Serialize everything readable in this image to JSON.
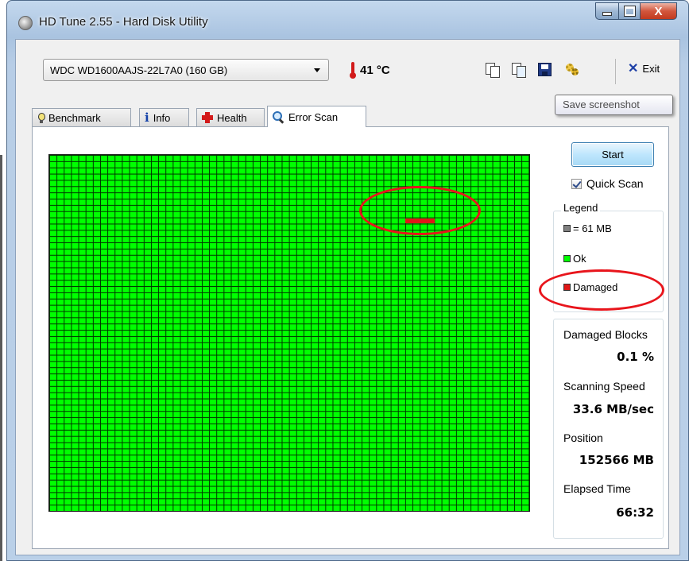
{
  "window": {
    "title": "HD Tune 2.55 - Hard Disk Utility",
    "buttons": {
      "minimize": "minimize",
      "maximize": "maximize",
      "close": "X"
    }
  },
  "toolbar": {
    "drive": "WDC WD1600AAJS-22L7A0 (160 GB)",
    "temperature": "41 °C",
    "exit_label": "Exit",
    "tooltip": "Save screenshot"
  },
  "tabs": [
    {
      "label": "Benchmark",
      "icon": "lightbulb-icon",
      "active": false
    },
    {
      "label": "Info",
      "icon": "info-icon",
      "active": false
    },
    {
      "label": "Health",
      "icon": "health-cross-icon",
      "active": false
    },
    {
      "label": "Error Scan",
      "icon": "magnifier-icon",
      "active": true
    }
  ],
  "error_scan": {
    "start_label": "Start",
    "quick_scan_label": "Quick Scan",
    "quick_scan_checked": true,
    "block_map": {
      "columns": 66,
      "rows": 57,
      "ok_color": "#00ff00",
      "damaged_color": "#e01818",
      "damaged_blocks": [
        {
          "row": 10,
          "col_start": 49,
          "col_end": 52
        }
      ]
    },
    "legend": {
      "title": "Legend",
      "block_size": "= 61 MB",
      "ok": "Ok",
      "damaged": "Damaged"
    },
    "stats": {
      "damaged_blocks_label": "Damaged Blocks",
      "damaged_blocks_value": "0.1 %",
      "speed_label": "Scanning Speed",
      "speed_value": "33.6 MB/sec",
      "position_label": "Position",
      "position_value": "152566 MB",
      "elapsed_label": "Elapsed Time",
      "elapsed_value": "66:32"
    }
  },
  "annotation_color": "#e8151c"
}
